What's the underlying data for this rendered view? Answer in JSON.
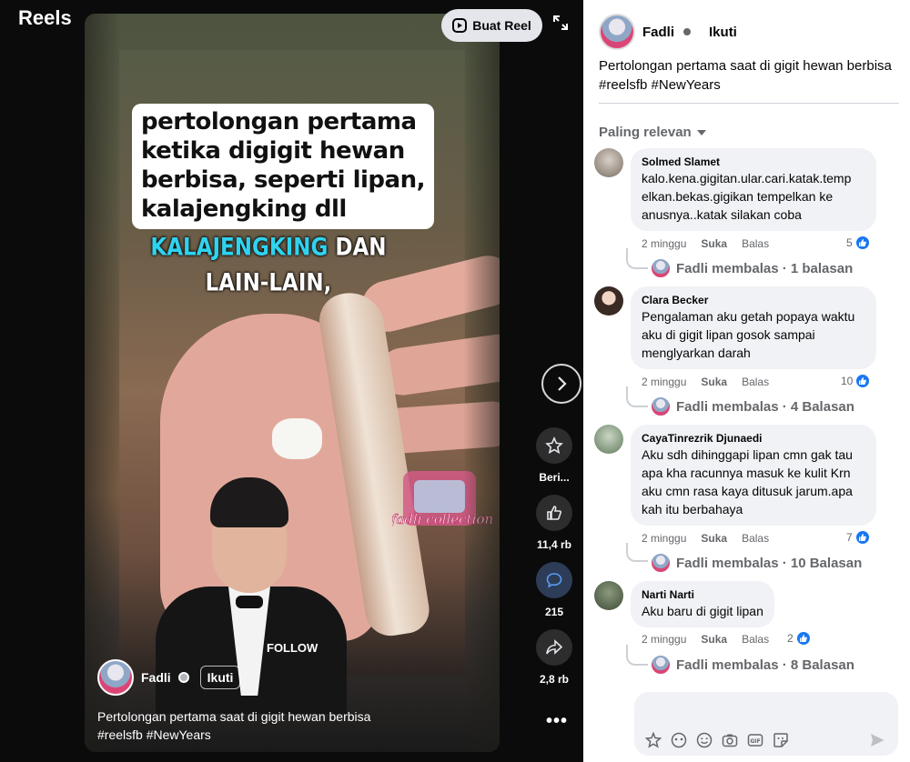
{
  "app": {
    "title": "Reels"
  },
  "top": {
    "create_reel": "Buat Reel"
  },
  "video": {
    "overlay_caption": [
      "pertolongan pertama",
      "ketika digigit hewan",
      "berbisa, seperti lipan,",
      "kalajengking dll"
    ],
    "subtitle_highlight": "KALAJENGKING",
    "subtitle_rest": " DAN LAIN-LAIN,",
    "follow_mark": "FOLLOW",
    "watermark": "fadli collection",
    "owner": {
      "name": "Fadli",
      "follow": "Ikuti"
    },
    "description_line1": "Pertolongan pertama saat di gigit hewan berbisa",
    "description_line2": "#reelsfb #NewYears"
  },
  "actions": {
    "star_label": "Beri...",
    "like_count": "11,4 rb",
    "comment_count": "215",
    "share_count": "2,8 rb"
  },
  "panel": {
    "author": "Fadli",
    "follow": "Ikuti",
    "description_line1": "Pertolongan pertama saat di gigit hewan berbisa",
    "description_line2": "#reelsfb #NewYears",
    "sort_label": "Paling relevan",
    "like_label": "Suka",
    "reply_label": "Balas",
    "comments": [
      {
        "author": "Solmed Slamet",
        "text": "kalo.kena.gigitan.ular.cari.katak.temp elkan.bekas.gigikan tempelkan ke anusnya..katak silakan coba",
        "time": "2 minggu",
        "likes": "5",
        "replies": "Fadli membalas · 1 balasan"
      },
      {
        "author": "Clara Becker",
        "text": "Pengalaman aku getah popaya waktu aku di gigit lipan gosok sampai menglyarkan darah",
        "time": "2 minggu",
        "likes": "10",
        "replies": "Fadli membalas · 4 Balasan"
      },
      {
        "author": "CayaTinrezrik Djunaedi",
        "text": "Aku sdh dihinggapi lipan cmn gak tau apa kha racunnya masuk ke kulit Krn aku cmn rasa kaya ditusuk jarum.apa kah itu berbahaya",
        "time": "2 minggu",
        "likes": "7",
        "replies": "Fadli membalas · 10 Balasan"
      },
      {
        "author": "Narti Narti",
        "text": "Aku baru di gigit lipan",
        "time": "2 minggu",
        "likes": "2",
        "replies": "Fadli membalas · 8 Balasan"
      }
    ]
  },
  "colors": {
    "accent": "#1877f2",
    "panel_bg": "#ffffff",
    "bubble_bg": "#f0f2f5",
    "subtitle_blue": "#2fd3f0"
  }
}
